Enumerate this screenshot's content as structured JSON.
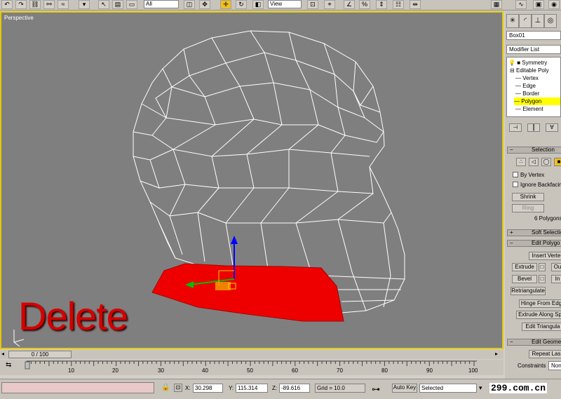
{
  "viewport": {
    "label": "Perspective",
    "overlay_text": "Delete",
    "overlay_color": "#d40000",
    "selection_color": "#ee0000",
    "wire_color": "#ffffff",
    "background": "#7f7f7f"
  },
  "toolbar": {
    "view_select": "View",
    "filter_select": "All"
  },
  "command_panel": {
    "object_name": "Box01",
    "modifier_list": "Modifier List",
    "stack": [
      {
        "label": "Symmetry",
        "indent": 1,
        "selected": false
      },
      {
        "label": "Editable Poly",
        "indent": 1,
        "selected": false
      },
      {
        "label": "Vertex",
        "indent": 2,
        "selected": false
      },
      {
        "label": "Edge",
        "indent": 2,
        "selected": false
      },
      {
        "label": "Border",
        "indent": 2,
        "selected": false
      },
      {
        "label": "Polygon",
        "indent": 2,
        "selected": true
      },
      {
        "label": "Element",
        "indent": 2,
        "selected": false
      }
    ],
    "selection_rollout": {
      "title": "Selection",
      "by_vertex": "By Vertex",
      "ignore_backfacing": "Ignore Backfacin",
      "shrink": "Shrink",
      "ring": "Ring",
      "status": "6 Polygons"
    },
    "soft_selection": "Soft Selectio",
    "edit_polygons": {
      "title": "Edit Polygo",
      "insert_vertex": "Insert Verte",
      "extrude": "Extrude",
      "outline": "Ou",
      "bevel": "Bevel",
      "inset": "In",
      "retriangulate": "Retriangulate",
      "hinge_from_edge": "Hinge From Edg",
      "extrude_along_spline": "Extrude Along Sp",
      "edit_triangulation": "Edit Triangula"
    },
    "edit_geometry": {
      "title": "Edit Geomet",
      "repeat_last": "Repeat Las",
      "constraints_label": "Constraints",
      "constraints_value": "Non"
    }
  },
  "timeline": {
    "slider_label": "0 / 100",
    "ticks": [
      "10",
      "20",
      "30",
      "40",
      "50",
      "60",
      "70",
      "80",
      "90",
      "100"
    ]
  },
  "status": {
    "x_label": "X:",
    "x_value": "30.298",
    "y_label": "Y:",
    "y_value": "115.314",
    "z_label": "Z:",
    "z_value": "-89.616",
    "grid": "Grid = 10.0",
    "auto_key": "Auto Key",
    "selected": "Selected",
    "watermark": "299.com.cn"
  }
}
